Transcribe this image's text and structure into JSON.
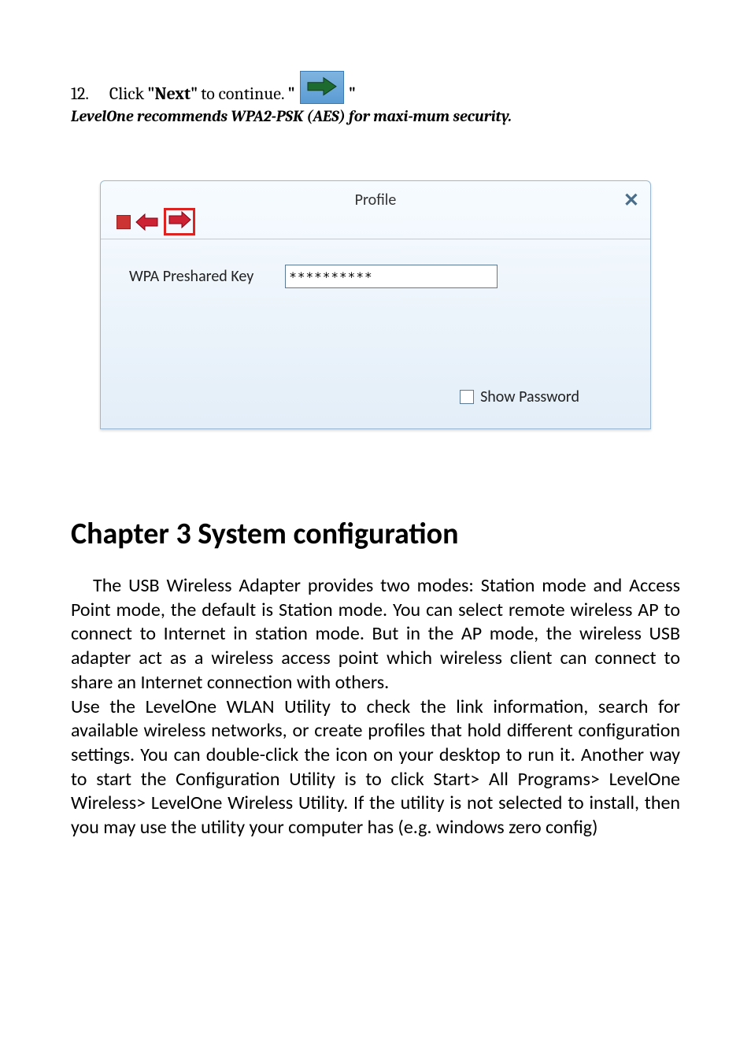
{
  "step": {
    "number": "12.",
    "prefix": "Click ",
    "bold1": "\"Next\"",
    "mid": " to continue. ",
    "quote_open": "\"",
    "quote_close": "\""
  },
  "recommend": "LevelOne recommends WPA2-PSK (AES) for maxi-mum security.",
  "dialog": {
    "title": "Profile",
    "close": "✕",
    "field_label": "WPA Preshared Key",
    "key_value": "**********",
    "show_password": "Show Password"
  },
  "chapter": {
    "heading": "Chapter 3 System configuration",
    "para1": "The USB Wireless Adapter provides two modes: Station mode and Access Point mode, the default is Station mode. You can select remote wireless AP to connect to Internet in station mode. But in the AP mode, the wireless USB adapter act as a wireless access point which wireless client can connect to share an Internet connection with others.",
    "para2": "Use the LevelOne WLAN Utility to check the link information, search for available wireless networks, or create profiles that hold different configuration settings. You can double-click the icon on your desktop to run it. Another way to start the Configuration Utility is to click Start> All Programs> LevelOne Wireless> LevelOne Wireless Utility. If the utility is not selected to install, then you may use the utility your computer has (e.g. windows zero config)"
  }
}
